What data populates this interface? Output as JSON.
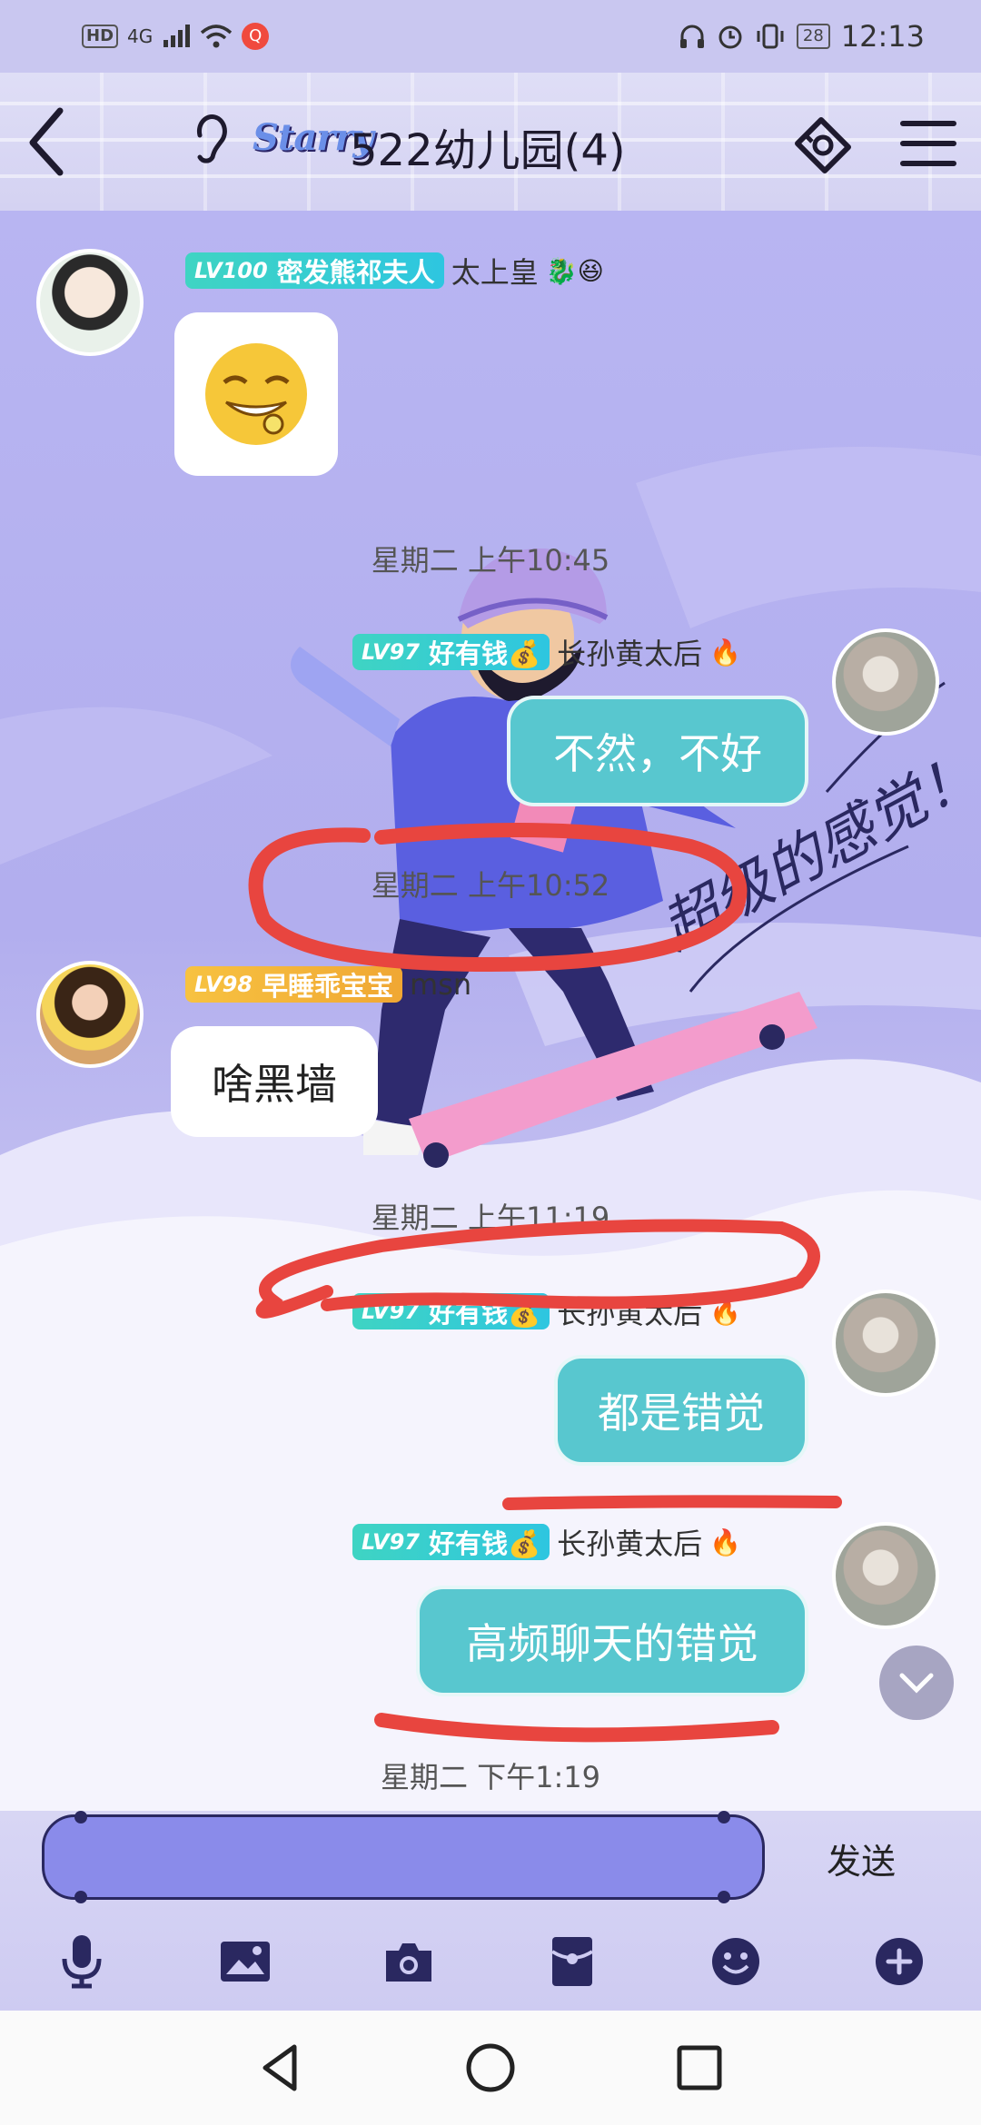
{
  "status_bar": {
    "left": [
      "HD",
      "4G",
      "📶",
      "📶"
    ],
    "notification_badge": "Q",
    "battery": "28",
    "time": "12:13"
  },
  "header": {
    "brand": "Starry",
    "title": "522幼儿园(4)"
  },
  "messages": [
    {
      "level": "LV100",
      "title": "密发熊祁夫人",
      "nick": "太上皇",
      "flair": "🐉😆"
    },
    {
      "timestamp": "星期二 上午10:45"
    },
    {
      "level": "LV97",
      "title": "好有钱💰",
      "nick": "长孙黄太后",
      "flair": "🔥",
      "text": "不然，不好"
    },
    {
      "timestamp": "星期二 上午10:52"
    },
    {
      "level": "LV98",
      "title": "早睡乖宝宝",
      "nick": "msn",
      "text": "啥黑墙"
    },
    {
      "timestamp": "星期二 上午11:19"
    },
    {
      "level": "LV97",
      "title": "好有钱💰",
      "nick": "长孙黄太后",
      "flair": "🔥",
      "text": "都是错觉"
    },
    {
      "level": "LV97",
      "title": "好有钱💰",
      "nick": "长孙黄太后",
      "flair": "🔥",
      "text": "高频聊天的错觉"
    },
    {
      "timestamp": "星期二 下午1:19"
    }
  ],
  "background_slogan": "超级的感觉！",
  "composer": {
    "input_value": "",
    "send_label": "发送"
  },
  "colors": {
    "accent_cyan": "#58c7cf",
    "annotation_red": "#e8453f",
    "input_purple": "#8a8bea"
  }
}
